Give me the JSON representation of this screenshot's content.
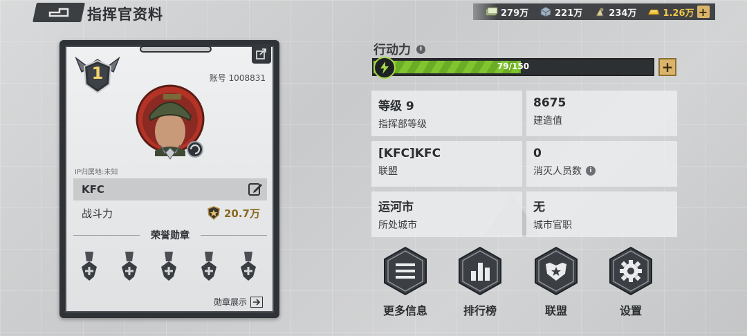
{
  "header": {
    "title": "指挥官资料",
    "resources": [
      {
        "name": "cash",
        "icon": "cash-icon",
        "value": "279万"
      },
      {
        "name": "steel",
        "icon": "steel-icon",
        "value": "221万"
      },
      {
        "name": "oil",
        "icon": "oil-icon",
        "value": "234万"
      },
      {
        "name": "gold",
        "icon": "gold-icon",
        "value": "1.26万"
      }
    ],
    "add_label": "+"
  },
  "profile": {
    "rank": "1",
    "account": "账号 1008831",
    "ip_location": "IP归属地:未知",
    "name": "KFC",
    "power_label": "战斗力",
    "power_value": "20.7万",
    "medals_title": "荣誉勋章",
    "medal_slots": 5,
    "medal_show_label": "勋章展示"
  },
  "stamina": {
    "label": "行动力",
    "info": "i",
    "current": 79,
    "max": 150,
    "text": "79/150",
    "add_label": "+"
  },
  "stats": [
    {
      "value": "等级 9",
      "label": "指挥部等级",
      "info": false
    },
    {
      "value": "8675",
      "label": "建造值",
      "info": false
    },
    {
      "value": "[KFC]KFC",
      "label": "联盟",
      "info": false
    },
    {
      "value": "0",
      "label": "消灭人员数",
      "info": true
    },
    {
      "value": "运河市",
      "label": "所处城市",
      "info": false
    },
    {
      "value": "无",
      "label": "城市官职",
      "info": false
    }
  ],
  "actions": [
    {
      "label": "更多信息",
      "icon": "menu-lines-icon"
    },
    {
      "label": "排行榜",
      "icon": "bar-chart-icon"
    },
    {
      "label": "联盟",
      "icon": "alliance-star-icon"
    },
    {
      "label": "设置",
      "icon": "gear-icon"
    }
  ],
  "colors": {
    "stamina_green": "#7fc52f",
    "gold_text": "#f1c94a",
    "power_gold": "#8a6a22",
    "hex_button": "#3b3f44"
  }
}
